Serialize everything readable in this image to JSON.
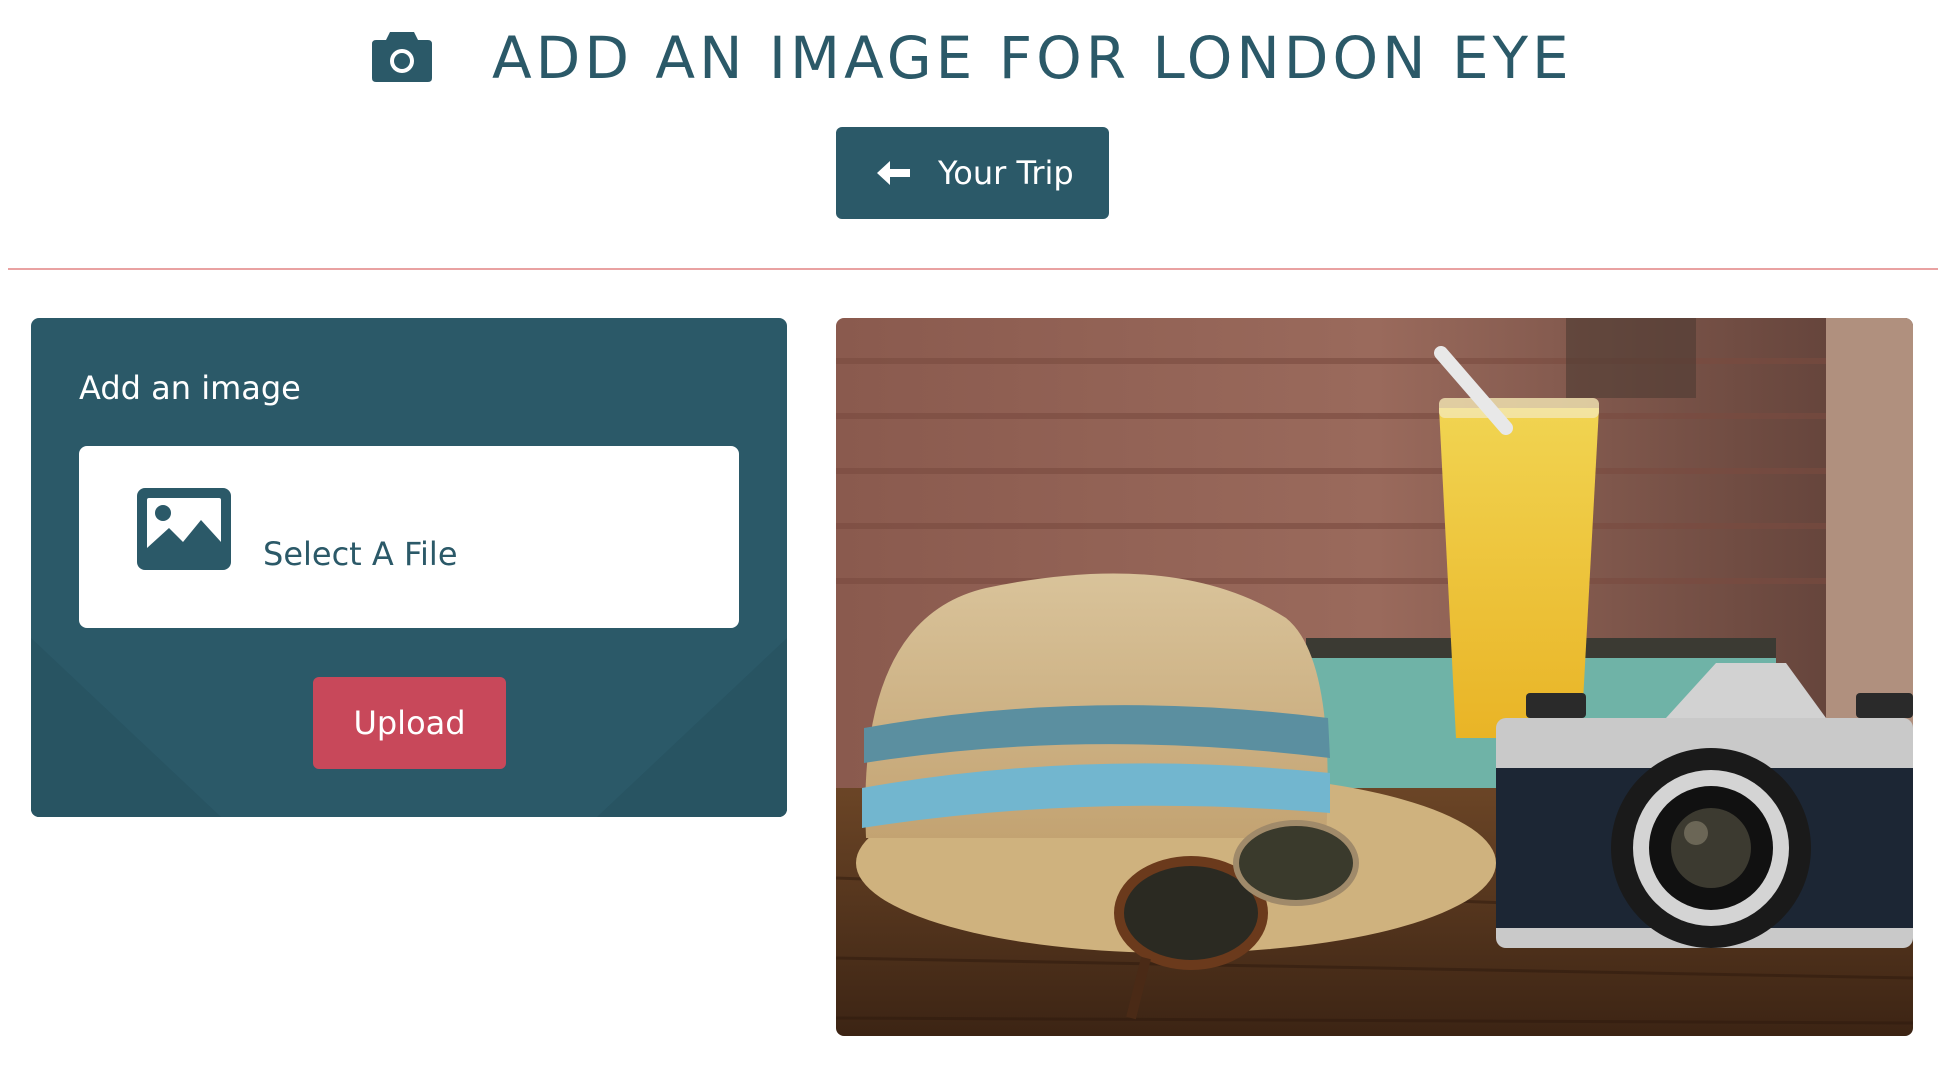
{
  "header": {
    "title": "ADD AN IMAGE FOR LONDON EYE",
    "icon": "camera-icon"
  },
  "back_button": {
    "label": "Your Trip",
    "icon": "arrow-left-icon"
  },
  "upload_panel": {
    "title": "Add an image",
    "file_select_label": "Select A File",
    "file_icon": "image-icon",
    "upload_label": "Upload"
  },
  "colors": {
    "primary": "#2b5968",
    "accent": "#c8485a",
    "divider": "#e9a2a2"
  }
}
